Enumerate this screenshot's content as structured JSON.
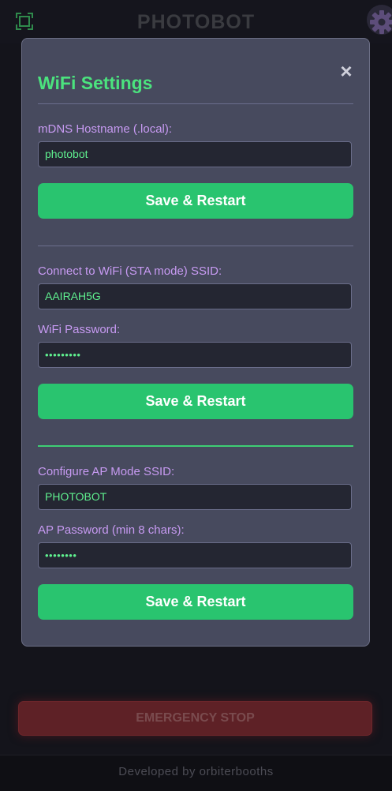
{
  "app": {
    "title": "PHOTOBOT",
    "emergency_stop_label": "EMERGENCY STOP",
    "footer_text": "Developed by orbiterbooths",
    "icons": {
      "fullscreen": "fullscreen-icon",
      "settings": "gear-icon"
    }
  },
  "modal": {
    "title": "WiFi Settings",
    "close_label": "×",
    "hostname": {
      "label": "mDNS Hostname (.local):",
      "value": "photobot",
      "button": "Save & Restart"
    },
    "sta": {
      "ssid_label": "Connect to WiFi (STA mode) SSID:",
      "ssid_value": "AAIRAH5G",
      "password_label": "WiFi Password:",
      "password_value": "•••••••••",
      "button": "Save & Restart"
    },
    "ap": {
      "ssid_label": "Configure AP Mode SSID:",
      "ssid_value": "PHOTOBOT",
      "password_label": "AP Password (min 8 chars):",
      "password_value": "••••••••",
      "button": "Save & Restart"
    }
  },
  "colors": {
    "accent_green": "#4be37e",
    "button_green": "#29c46f",
    "label_purple": "#c79af2",
    "modal_bg": "#474a5e",
    "emergency_red": "#5e2126"
  }
}
